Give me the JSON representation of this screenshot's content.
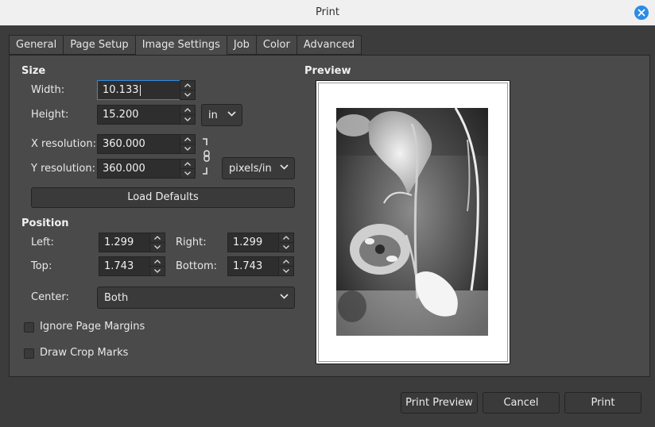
{
  "window": {
    "title": "Print"
  },
  "tabs": [
    "General",
    "Page Setup",
    "Image Settings",
    "Job",
    "Color",
    "Advanced"
  ],
  "active_tab": "Image Settings",
  "size": {
    "heading": "Size",
    "width_label": "Width:",
    "width_value": "10.133",
    "height_label": "Height:",
    "height_value": "15.200",
    "unit": "in",
    "xres_label": "X resolution:",
    "xres_value": "360.000",
    "yres_label": "Y resolution:",
    "yres_value": "360.000",
    "res_unit": "pixels/in",
    "load_defaults": "Load Defaults"
  },
  "position": {
    "heading": "Position",
    "left_label": "Left:",
    "left_value": "1.299",
    "right_label": "Right:",
    "right_value": "1.299",
    "top_label": "Top:",
    "top_value": "1.743",
    "bottom_label": "Bottom:",
    "bottom_value": "1.743",
    "center_label": "Center:",
    "center_value": "Both"
  },
  "options": {
    "ignore_margins": "Ignore Page Margins",
    "ignore_margins_checked": false,
    "crop_marks": "Draw Crop Marks",
    "crop_marks_checked": false
  },
  "preview": {
    "heading": "Preview"
  },
  "footer": {
    "print_preview": "Print Preview",
    "cancel": "Cancel",
    "print": "Print"
  },
  "colors": {
    "accent": "#2b8ce6",
    "background": "#3c3c3c",
    "panel": "#4a4a4a",
    "titlebar": "#f0f0f0"
  }
}
